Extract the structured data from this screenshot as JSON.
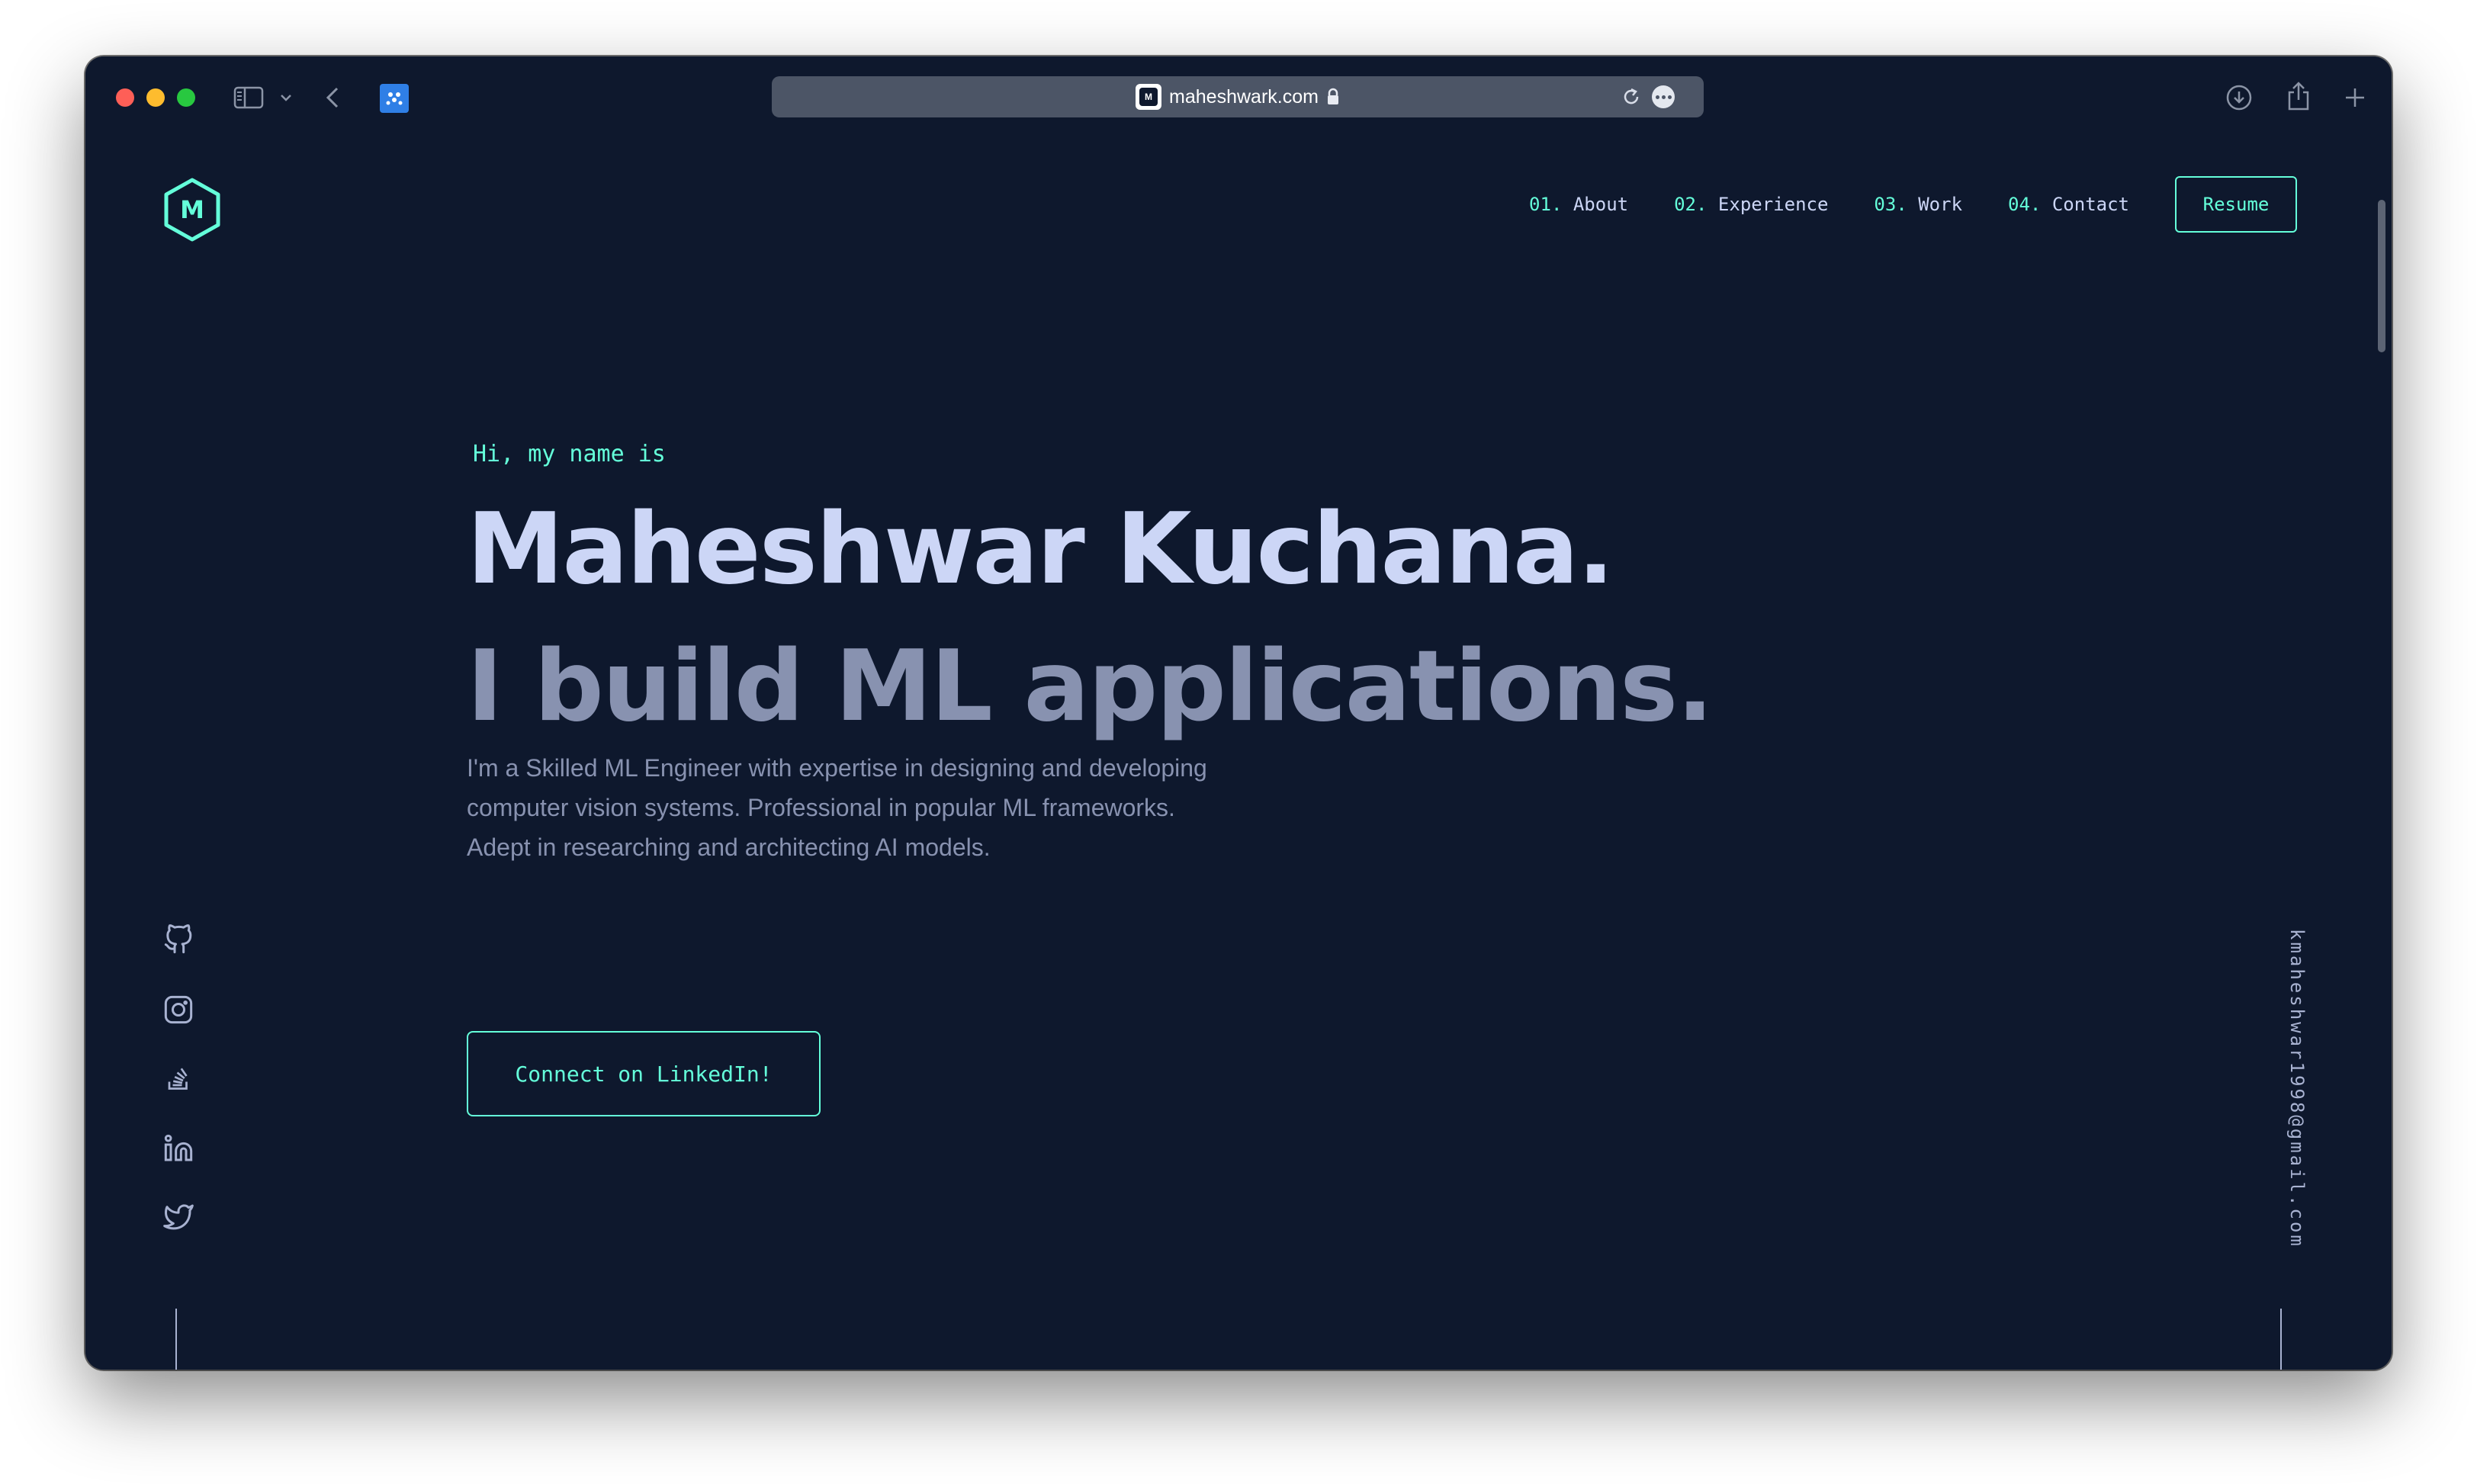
{
  "browser": {
    "url": "maheshwark.com",
    "favicon_letter": "M",
    "icons": [
      "sidebar-icon",
      "chevron-down-icon",
      "back-arrow-icon",
      "extension-icon",
      "lock-icon",
      "reload-icon",
      "more-icon",
      "download-icon",
      "share-icon",
      "plus-icon"
    ]
  },
  "site": {
    "logo_letter": "M",
    "nav": [
      {
        "num": "01.",
        "label": "About"
      },
      {
        "num": "02.",
        "label": "Experience"
      },
      {
        "num": "03.",
        "label": "Work"
      },
      {
        "num": "04.",
        "label": "Contact"
      }
    ],
    "resume_label": "Resume",
    "hero": {
      "greeting": "Hi, my name is",
      "name": "Maheshwar Kuchana.",
      "tagline": "I build ML applications.",
      "description_lines": [
        "I'm a Skilled ML Engineer with expertise in designing and developing",
        "computer vision systems. Professional in popular ML frameworks.",
        "Adept in researching and architecting AI models."
      ],
      "cta_label": "Connect on LinkedIn!"
    },
    "social_icons": [
      "github-icon",
      "instagram-icon",
      "stackoverflow-icon",
      "linkedin-icon",
      "twitter-icon"
    ],
    "email": "kmaheshwar1998@gmail.com"
  },
  "colors": {
    "background": "#0e182d",
    "accent": "#64ffda",
    "heading": "#ccd6f6",
    "text": "#8892b0"
  }
}
